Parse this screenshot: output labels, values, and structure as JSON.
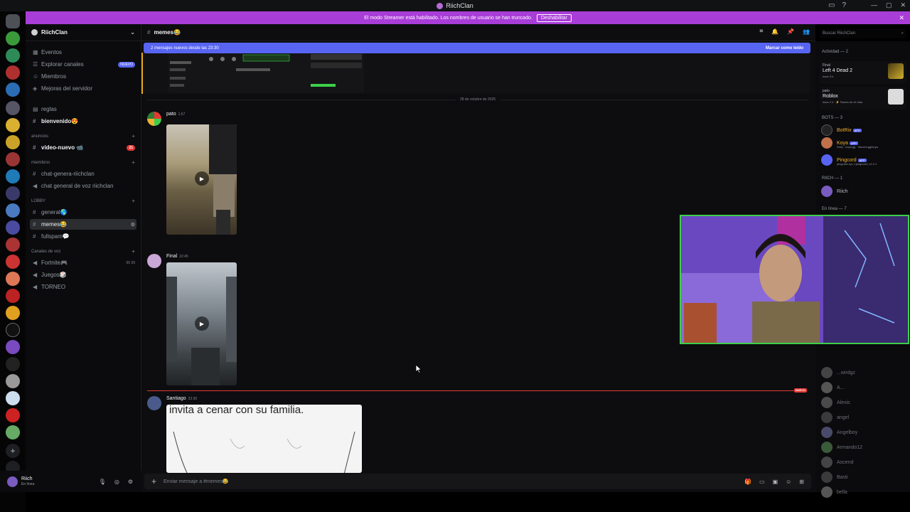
{
  "window": {
    "title": "RiichClan"
  },
  "banner": {
    "text": "El modo Streamer está habilitado. Los nombres de usuario se han truncado.",
    "button": "Deshabilitar"
  },
  "guild": {
    "name": "RiichClan"
  },
  "sidebar": {
    "top_items": [
      {
        "label": "Eventos",
        "icon": "calendar-icon"
      },
      {
        "label": "Explorar canales",
        "icon": "compass-icon",
        "badge": "NUEVO"
      },
      {
        "label": "Miembros",
        "icon": "members-icon"
      },
      {
        "label": "Mejoras del servidor",
        "icon": "boost-icon"
      }
    ],
    "channels_top": [
      {
        "label": "reglas",
        "icon": "rules-icon"
      },
      {
        "label": "bienvenido😍",
        "icon": "hash-icon"
      }
    ],
    "cat_anuncios": "anuncios",
    "anuncios": [
      {
        "label": "video-nuevo 📹",
        "count": "21"
      }
    ],
    "cat_miembros": "miembros",
    "miembros": [
      {
        "label": "chat-genera-riichclan"
      },
      {
        "label": "chat general de voz riichclan"
      }
    ],
    "cat_lobby": "LOBBY",
    "lobby": [
      {
        "label": "general🌎"
      },
      {
        "label": "memes😂"
      },
      {
        "label": "fullspam💬"
      }
    ],
    "cat_voz": "Canales de voz",
    "voz": [
      {
        "label": "Fortnite🎮",
        "vc": "00 39"
      },
      {
        "label": "Juegos🎲"
      },
      {
        "label": "TORNEO"
      }
    ]
  },
  "user": {
    "name": "Riich",
    "status": "En línea"
  },
  "channel": {
    "name": "memes😂",
    "new_messages": "2 mensajes nuevos desde las 23:30",
    "mark_read": "Marcar como leído",
    "date": "28 de octubre de 2025",
    "new_tag": "NUEVO",
    "composer_placeholder": "Enviar mensaje a #memes😂"
  },
  "messages": [
    {
      "author": "pato",
      "time": "1:57"
    },
    {
      "author": "Final",
      "time": "22:45"
    },
    {
      "author": "Santiago",
      "time": "23:30",
      "caption": "invita a cenar con su familia."
    }
  ],
  "search": {
    "placeholder": "Buscar RiichClan"
  },
  "members": {
    "activity_header": "Actividad — 2",
    "activities": [
      {
        "user": "Final",
        "game": "Left 4 Dead 2",
        "time": "hace 3 h"
      },
      {
        "user": "pato",
        "game": "Roblox",
        "time": "hace 2 h · ⚡ Racha de x9 días"
      }
    ],
    "bots_header": "BOTS — 3",
    "bots": [
      {
        "name": "BotRix",
        "app": "APP",
        "color": "#f0b232"
      },
      {
        "name": "Koya",
        "app": "APP",
        "color": "#f0b232",
        "sub": "/help · koya.gg · discord.gg/koya"
      },
      {
        "name": "Pingcord",
        "app": "APP",
        "color": "#f0b232",
        "sub": "pingcord.xyz | !pingcord | v2.2.1"
      }
    ],
    "riich_header": "RIICH — 1",
    "riich": [
      {
        "name": "Riich",
        "color": "#b5bac1"
      }
    ],
    "online_header": "En línea — 7",
    "online": [
      {
        "name": "...wirdgz"
      },
      {
        "name": "A..."
      },
      {
        "name": "Alexis"
      },
      {
        "name": "angel"
      },
      {
        "name": "Angelboy"
      },
      {
        "name": "Armando12"
      },
      {
        "name": "Ascend"
      },
      {
        "name": "Basti"
      },
      {
        "name": "bella"
      }
    ]
  }
}
